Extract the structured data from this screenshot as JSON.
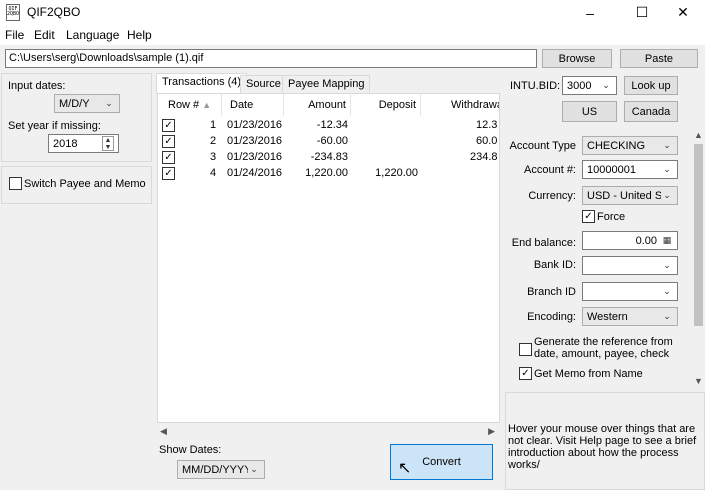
{
  "window": {
    "title": "QIF2QBO",
    "icon_text": "QIF\n2QBO"
  },
  "menu": [
    "File",
    "Edit",
    "Language",
    "Help"
  ],
  "file_path": "C:\\Users\\serg\\Downloads\\sample (1).qif",
  "buttons": {
    "browse": "Browse",
    "paste": "Paste",
    "lookup": "Look up",
    "us": "US",
    "canada": "Canada",
    "convert": "Convert"
  },
  "left_panel": {
    "input_dates_label": "Input dates:",
    "input_dates_value": "M/D/Y",
    "set_year_label": "Set year if missing:",
    "set_year_value": "2018",
    "switch_payee_label": "Switch Payee and Memo",
    "switch_payee_checked": false
  },
  "tabs": [
    "Transactions (4)",
    "Source",
    "Payee Mapping"
  ],
  "table": {
    "columns": [
      "Row #",
      "Date",
      "Amount",
      "Deposit",
      "Withdrawa"
    ],
    "rows": [
      {
        "checked": true,
        "row": "1",
        "date": "01/23/2016",
        "amount": "-12.34",
        "deposit": "",
        "withdrawal": "12.3"
      },
      {
        "checked": true,
        "row": "2",
        "date": "01/23/2016",
        "amount": "-60.00",
        "deposit": "",
        "withdrawal": "60.0"
      },
      {
        "checked": true,
        "row": "3",
        "date": "01/23/2016",
        "amount": "-234.83",
        "deposit": "",
        "withdrawal": "234.8"
      },
      {
        "checked": true,
        "row": "4",
        "date": "01/24/2016",
        "amount": "1,220.00",
        "deposit": "1,220.00",
        "withdrawal": ""
      }
    ]
  },
  "show_dates": {
    "label": "Show Dates:",
    "value": "MM/DD/YYYY"
  },
  "intu_bid": {
    "label": "INTU.BID:",
    "value": "3000"
  },
  "form": {
    "account_type_label": "Account Type",
    "account_type_value": "CHECKING",
    "account_num_label": "Account #:",
    "account_num_value": "10000001",
    "currency_label": "Currency:",
    "currency_value": "USD - United Sta",
    "force_label": "Force",
    "force_checked": true,
    "end_balance_label": "End balance:",
    "end_balance_value": "0.00",
    "bank_id_label": "Bank ID:",
    "bank_id_value": "",
    "branch_id_label": "Branch ID",
    "branch_id_value": "",
    "encoding_label": "Encoding:",
    "encoding_value": "Western",
    "generate_ref_label": "Generate the reference from date, amount, payee, check",
    "generate_ref_checked": false,
    "get_memo_label": "Get Memo from Name",
    "get_memo_checked": true
  },
  "info_text": "Hover your mouse over things that are not clear. Visit Help page to see a brief introduction about how the process works/"
}
